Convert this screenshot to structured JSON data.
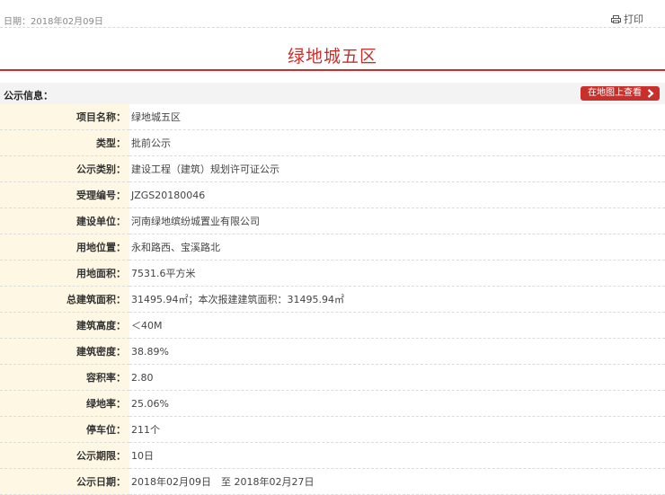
{
  "header": {
    "date": "日期：2018年02月09日",
    "print_label": "打印",
    "print_icon": "printer-icon"
  },
  "title": "绿地城五区",
  "section": {
    "title": "公示信息：",
    "map_button": "在地图上查看",
    "map_button_icon": "chevron-right-icon"
  },
  "rows": [
    {
      "label": "项目名称：",
      "value": "绿地城五区"
    },
    {
      "label": "类型：",
      "value": "批前公示"
    },
    {
      "label": "公示类别：",
      "value": "建设工程（建筑）规划许可证公示"
    },
    {
      "label": "受理编号：",
      "value": "JZGS20180046"
    },
    {
      "label": "建设单位：",
      "value": "河南绿地缤纷城置业有限公司"
    },
    {
      "label": "用地位置：",
      "value": "永和路西、宝溪路北"
    },
    {
      "label": "用地面积：",
      "value": "7531.6平方米"
    },
    {
      "label": "总建筑面积：",
      "value": "31495.94㎡；本次报建建筑面积：31495.94㎡"
    },
    {
      "label": "建筑高度：",
      "value": "＜40M"
    },
    {
      "label": "建筑密度：",
      "value": "38.89%"
    },
    {
      "label": "容积率：",
      "value": "2.80"
    },
    {
      "label": "绿地率：",
      "value": "25.06%"
    },
    {
      "label": "停车位：",
      "value": "211个"
    },
    {
      "label": "公示期限：",
      "value": "10日"
    },
    {
      "label": "公示日期：",
      "value": "2018年02月09日　至 2018年02月27日"
    }
  ],
  "colors": {
    "accent": "#c9302c",
    "label_bg": "#fdf7e3"
  }
}
